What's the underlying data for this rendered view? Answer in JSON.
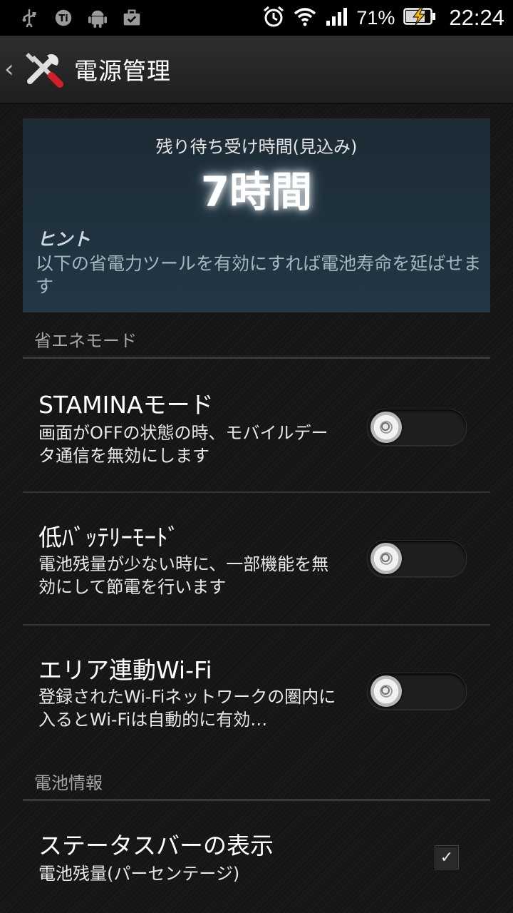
{
  "status_bar": {
    "icons_left": [
      "usb-icon",
      "ti-icon",
      "android-icon",
      "briefcase-icon"
    ],
    "battery_percent": "71%",
    "time": "22:24",
    "icons_right": [
      "alarm-icon",
      "wifi-icon",
      "signal-icon",
      "battery-charging-icon"
    ]
  },
  "action_bar": {
    "title": "電源管理",
    "app_icon": "tools-icon"
  },
  "estimate": {
    "label": "残り待ち受け時間(見込み)",
    "value": "7時間",
    "hint_title": "ヒント",
    "hint_text": "以下の省電力ツールを有効にすれば電池寿命を延ばせます"
  },
  "sections": {
    "power_saving": "省エネモード",
    "battery_info": "電池情報"
  },
  "settings": [
    {
      "title": "STAMINAモード",
      "subtitle": "画面がOFFの状態の時、モバイルデータ通信を無効にします",
      "enabled": false
    },
    {
      "title": "低ﾊﾞｯﾃﾘｰﾓｰﾄﾞ",
      "subtitle": "電池残量が少ない時に、一部機能を無効にして節電を行います",
      "enabled": false
    },
    {
      "title": "エリア連動Wi-Fi",
      "subtitle": "登録されたWi-Fiネットワークの圏内に入るとWi-Fiは自動的に有効…",
      "enabled": false
    }
  ],
  "status_bar_display": {
    "title": "ステータスバーの表示",
    "subtitle": "電池残量(パーセンテージ)",
    "checked": true
  }
}
